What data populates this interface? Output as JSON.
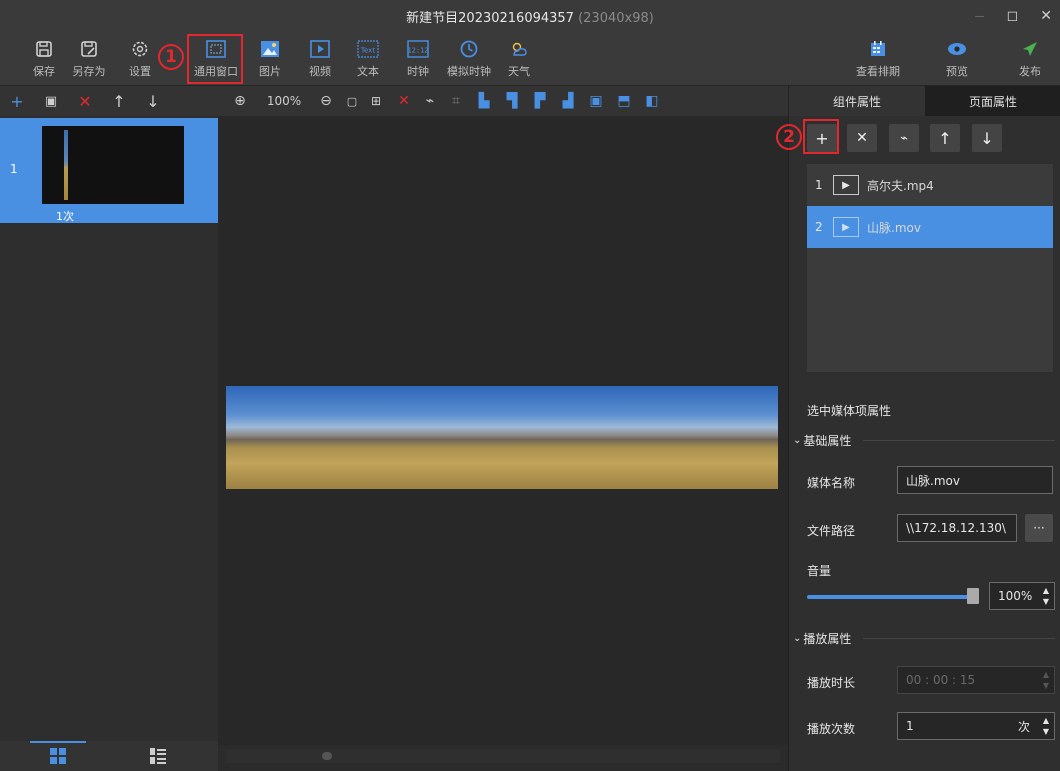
{
  "window": {
    "title": "新建节目20230216094357",
    "title_dim": " (23040x98)",
    "minimize": "—",
    "maximize": "◻",
    "close": "✕"
  },
  "toolbar": {
    "save": "保存",
    "save_as": "另存为",
    "settings": "设置",
    "general_window": "通用窗口",
    "image": "图片",
    "video": "视频",
    "text": "文本",
    "clock": "时钟",
    "analog_clock": "模拟时钟",
    "weather": "天气",
    "view_schedule": "查看排期",
    "preview": "预览",
    "publish": "发布"
  },
  "annotations": {
    "step1": "1",
    "step2": "2"
  },
  "canvas": {
    "zoom": "100%"
  },
  "pages": [
    {
      "index": "1",
      "play_count": "1次"
    }
  ],
  "right_panel": {
    "tabs": {
      "component": "组件属性",
      "page": "页面属性"
    },
    "media_items": [
      {
        "index": "1",
        "name": "高尔夫.mp4"
      },
      {
        "index": "2",
        "name": "山脉.mov"
      }
    ],
    "selected_title": "选中媒体项属性",
    "basic_group": "基础属性",
    "media_name_label": "媒体名称",
    "media_name_value": "山脉.mov",
    "file_path_label": "文件路径",
    "file_path_value": "\\\\172.18.12.130\\",
    "dots": "···",
    "volume_label": "音量",
    "volume_value": "100%",
    "volume_level": 1.0,
    "play_group": "播放属性",
    "duration_label": "播放时长",
    "duration_value": "00 : 00 : 15",
    "count_label": "播放次数",
    "count_value": "1",
    "count_unit": "次"
  },
  "colors": {
    "accent": "#4a90e2",
    "highlight": "#e0282e",
    "publish": "#4caf50"
  }
}
